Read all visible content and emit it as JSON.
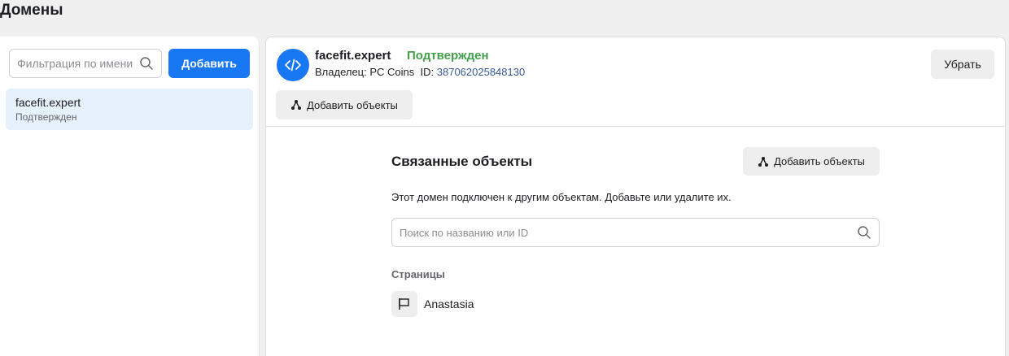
{
  "page": {
    "title": "Домены"
  },
  "sidebar": {
    "filter_placeholder": "Фильтрация по имени",
    "add_label": "Добавить",
    "items": [
      {
        "name": "facefit.expert",
        "status": "Подтвержден"
      }
    ]
  },
  "detail": {
    "domain": "facefit.expert",
    "status": "Подтвержден",
    "owner_label": "Владелец: PC Coins",
    "id_label": "ID:",
    "id_value": "387062025848130",
    "remove_label": "Убрать",
    "add_objects_label": "Добавить объекты",
    "linked": {
      "title": "Связанные объекты",
      "add_objects_label": "Добавить объекты",
      "description": "Этот домен подключен к другим объектам. Добавьте или удалите их.",
      "search_placeholder": "Поиск по названию или ID",
      "pages_heading": "Страницы",
      "pages": [
        {
          "name": "Anastasia"
        }
      ]
    }
  },
  "colors": {
    "accent": "#1877f2",
    "verified": "#42a04b",
    "selected_bg": "#e7f0fd",
    "id_link": "#385898"
  },
  "icons": {
    "search": "search-icon",
    "code": "code-icon",
    "objects": "objects-icon",
    "flag": "flag-icon"
  }
}
